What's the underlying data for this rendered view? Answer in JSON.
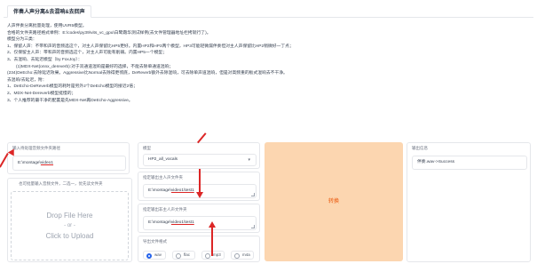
{
  "tab": {
    "label": "伴奏人声分离&去混响&去回声"
  },
  "description": [
    "人声伴奏分离批量处理，使用UVR5模型。",
    "合格的文件夹路径格式举例：E:\\codes\\py39\\vits_vc_gpu\\白鹭霜华测试样例(去文件管理器地址栏拷就行了)。",
    "模型分为三类：",
    "1、保留人声：不带和声的音频选这个，对主人声保留比HP5更好。内置HP2和HP3两个模型，HP3可能轻微漏伴奏但对主人声保留比HP2稍微好一丁点；",
    "2、仅保留主人声：带和声的音频选这个，对主人声可能有削弱。内置HP5一个模型；",
    "3、去混响、去延迟模型（by FoxJoy）：",
    "(1)MDX-Net(onnx_dereverb):对于双通道混响是最好的选择，不能去除单通道混响；",
    "(234)DeEcho:去除延迟效果。Aggressive比Normal去除得更彻底，DeReverb额外去除混响，可去除单声道混响，但是对高频重的板式混响去不干净。",
    "去混响/去延迟，附：",
    "1、DeEcho-DeReverb模型的耗时是另外2个DeEcho模型的接近2倍；",
    "2、MDX-Net-Dereverb模型挺慢的；",
    "3、个人推荐的最干净的配置是先MDX-Net再DeEcho-Aggressive。"
  ],
  "input_dir": {
    "label": "输入待处理音频文件夹路径",
    "value_prefix": "E:\\montage\\",
    "value_marked": "video1"
  },
  "upload": {
    "label": "也可批量输入音频文件，二选一，优先读文件夹",
    "drop_text": "Drop File Here",
    "or_text": "- or -",
    "click_text": "Click to Upload"
  },
  "model": {
    "label": "模型",
    "value": "HP2_all_vocals",
    "arrow": "▾"
  },
  "vocal_out": {
    "label": "指定输出主人声文件夹",
    "value_prefix": "E:\\montage\\",
    "value_marked": "video1\\test1"
  },
  "inst_out": {
    "label": "指定输出非主人声文件夹",
    "value_prefix": "E:\\montage\\",
    "value_marked": "video1\\test1"
  },
  "format": {
    "label": "导出文件格式",
    "options": [
      "wav",
      "flac",
      "mp3",
      "m4a"
    ],
    "selected": "wav"
  },
  "convert": {
    "label": "转换"
  },
  "output_info": {
    "label": "输出信息",
    "value": "伴奏.wav->Success"
  },
  "colors": {
    "accent": "#fcd6b0",
    "accent_text": "#ea580c",
    "annotation": "#dc2626",
    "radio_selected": "#2563eb"
  }
}
